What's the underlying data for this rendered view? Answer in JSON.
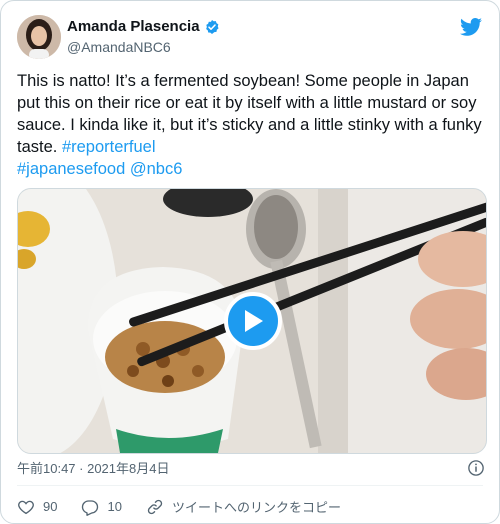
{
  "author": {
    "name": "Amanda Plasencia",
    "handle": "@AmandaNBC6"
  },
  "tweet": {
    "text_before": "This is natto! It’s a fermented soybean! Some people in Japan put this on their rice or eat it by itself with a little mustard or soy sauce. I kinda like it, but it’s sticky and a little stinky with a funky taste. ",
    "hashtag_1": "#reporterfuel",
    "hashtag_2": "#japanesefood",
    "mention": "@nbc6"
  },
  "meta": {
    "timestamp": "午前10:47 · 2021年8月4日"
  },
  "actions": {
    "likes": "90",
    "replies": "10",
    "copy_link": "ツイートへのリンクをコピー"
  },
  "colors": {
    "accent": "#1d9bf0",
    "text": "#0f1419",
    "muted": "#536471",
    "border": "#cfd9de"
  },
  "icons": [
    "verified-badge-icon",
    "twitter-bird-icon",
    "play-icon",
    "info-icon",
    "heart-icon",
    "reply-icon",
    "link-icon"
  ]
}
